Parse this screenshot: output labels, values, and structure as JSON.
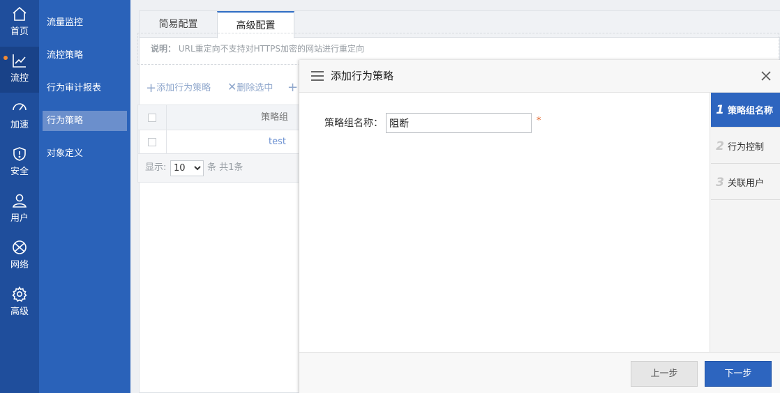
{
  "nav": {
    "items": [
      {
        "label": "首页",
        "icon": "home-icon"
      },
      {
        "label": "流控",
        "icon": "chart-line-icon"
      },
      {
        "label": "加速",
        "icon": "speedometer-icon"
      },
      {
        "label": "安全",
        "icon": "shield-icon"
      },
      {
        "label": "用户",
        "icon": "user-icon"
      },
      {
        "label": "网络",
        "icon": "globe-icon"
      },
      {
        "label": "高级",
        "icon": "gear-icon"
      }
    ],
    "active": "流控"
  },
  "submenu": {
    "items": [
      "流量监控",
      "流控策略",
      "行为审计报表",
      "行为策略",
      "对象定义"
    ],
    "active": "行为策略"
  },
  "tabs": [
    {
      "label": "简易配置"
    },
    {
      "label": "高级配置"
    }
  ],
  "note": {
    "label": "说明：",
    "text": "URL重定向不支持对HTTPS加密的网站进行重定向"
  },
  "toolbar": {
    "add_label": "添加行为策略",
    "delete_label": "删除选中"
  },
  "table": {
    "header": "策略组",
    "rows": [
      {
        "name": "test"
      }
    ]
  },
  "pager": {
    "show_label": "显示:",
    "page_size": "10",
    "summary": "条 共1条"
  },
  "modal": {
    "title": "添加行为策略",
    "form": {
      "name_label": "策略组名称：",
      "name_value": "阻断",
      "required_mark": "*"
    },
    "steps": [
      {
        "num": "1",
        "label": "策略组名称"
      },
      {
        "num": "2",
        "label": "行为控制"
      },
      {
        "num": "3",
        "label": "关联用户"
      }
    ],
    "prev_label": "上一步",
    "next_label": "下一步"
  },
  "colors": {
    "nav_bg": "#1f4e9c",
    "submenu_bg": "#2a62b9",
    "accent": "#2d65bf",
    "required": "#e0642a"
  }
}
